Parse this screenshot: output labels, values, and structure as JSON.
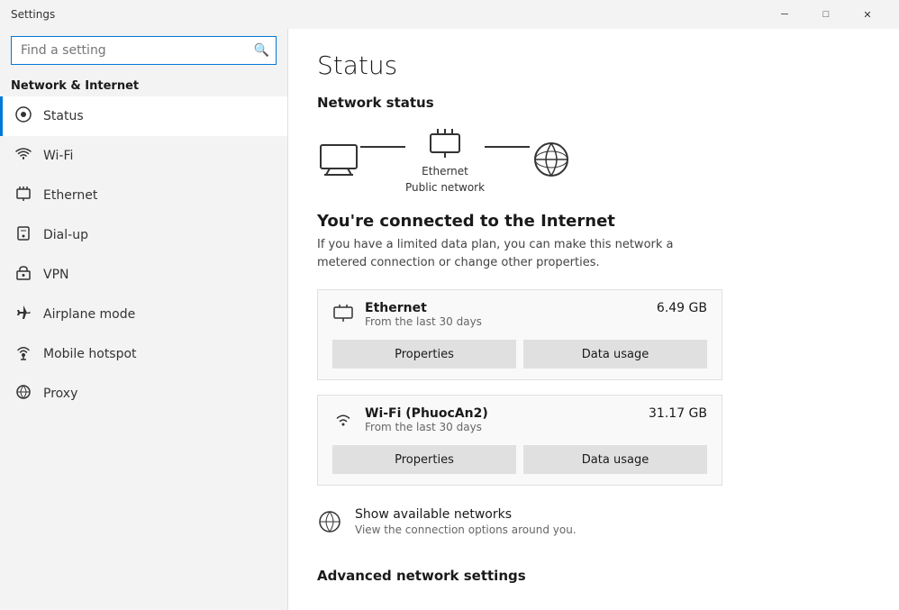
{
  "titlebar": {
    "title": "Settings",
    "minimize_label": "─",
    "maximize_label": "□",
    "close_label": "✕"
  },
  "sidebar": {
    "search_placeholder": "Find a setting",
    "category_label": "Network & Internet",
    "items": [
      {
        "id": "status",
        "label": "Status",
        "icon": "⊙",
        "active": true
      },
      {
        "id": "wifi",
        "label": "Wi-Fi",
        "icon": "wifi",
        "active": false
      },
      {
        "id": "ethernet",
        "label": "Ethernet",
        "icon": "ethernet",
        "active": false
      },
      {
        "id": "dialup",
        "label": "Dial-up",
        "icon": "phone",
        "active": false
      },
      {
        "id": "vpn",
        "label": "VPN",
        "icon": "vpn",
        "active": false
      },
      {
        "id": "airplane",
        "label": "Airplane mode",
        "icon": "airplane",
        "active": false
      },
      {
        "id": "hotspot",
        "label": "Mobile hotspot",
        "icon": "hotspot",
        "active": false
      },
      {
        "id": "proxy",
        "label": "Proxy",
        "icon": "proxy",
        "active": false
      }
    ]
  },
  "content": {
    "page_title": "Status",
    "network_status_title": "Network status",
    "diagram": {
      "ethernet_label": "Ethernet",
      "ethernet_sub": "Public network"
    },
    "connection_heading": "You're connected to the Internet",
    "connection_desc": "If you have a limited data plan, you can make this network a metered connection or change other properties.",
    "network_cards": [
      {
        "id": "ethernet",
        "name": "Ethernet",
        "sub": "From the last 30 days",
        "usage": "6.49 GB",
        "properties_label": "Properties",
        "data_usage_label": "Data usage"
      },
      {
        "id": "wifi",
        "name": "Wi-Fi (PhuocAn2)",
        "sub": "From the last 30 days",
        "usage": "31.17 GB",
        "properties_label": "Properties",
        "data_usage_label": "Data usage"
      }
    ],
    "show_networks": {
      "title": "Show available networks",
      "desc": "View the connection options around you."
    },
    "advanced_title": "Advanced network settings"
  }
}
